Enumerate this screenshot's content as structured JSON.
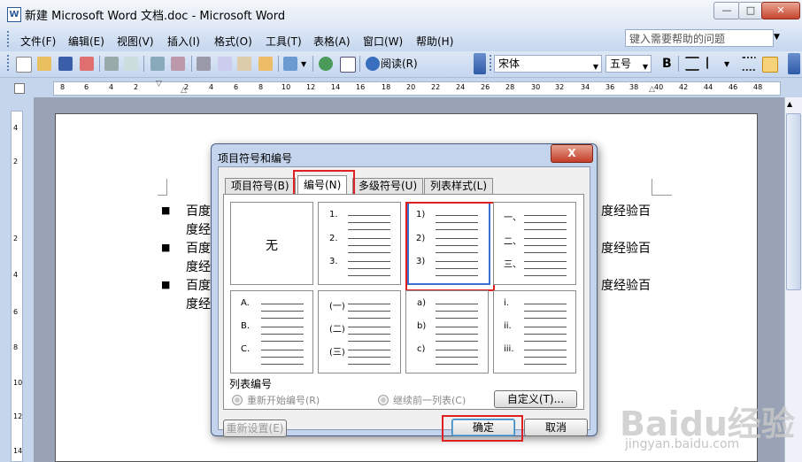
{
  "window": {
    "title": "新建 Microsoft Word 文档.doc - Microsoft Word"
  },
  "menu": [
    "文件(F)",
    "编辑(E)",
    "视图(V)",
    "插入(I)",
    "格式(O)",
    "工具(T)",
    "表格(A)",
    "窗口(W)",
    "帮助(H)"
  ],
  "help_search": {
    "placeholder": "键入需要帮助的问题"
  },
  "toolbar": {
    "reading_label": "阅读(R)",
    "font_name": "宋体",
    "font_size": "五号",
    "bold": "B"
  },
  "ruler": {
    "numbers": [
      "8",
      "6",
      "4",
      "2",
      "2",
      "4",
      "6",
      "8",
      "10",
      "12",
      "14",
      "16",
      "18",
      "20",
      "22",
      "24",
      "26",
      "28",
      "30",
      "32",
      "34",
      "36",
      "38",
      "40",
      "42",
      "44",
      "46",
      "48"
    ]
  },
  "vruler": {
    "numbers": [
      "4",
      "2",
      "2",
      "4",
      "6",
      "8",
      "10",
      "12",
      "14"
    ]
  },
  "document": {
    "left_lines": [
      "百度",
      "度经",
      "百度",
      "度经",
      "百度",
      "度经"
    ],
    "right_lines": [
      "度经验百",
      "度经验百",
      "度经验百"
    ]
  },
  "dialog": {
    "title": "项目符号和编号",
    "close_label": "X",
    "tabs": [
      "项目符号(B)",
      "编号(N)",
      "多级符号(U)",
      "列表样式(L)"
    ],
    "active_tab": 1,
    "none_label": "无",
    "styles": [
      [
        "1.",
        "2.",
        "3."
      ],
      [
        "1)",
        "2)",
        "3)"
      ],
      [
        "一、",
        "二、",
        "三、"
      ],
      [
        "A.",
        "B.",
        "C."
      ],
      [
        "(一)",
        "(二)",
        "(三)"
      ],
      [
        "a)",
        "b)",
        "c)"
      ],
      [
        "i.",
        "ii.",
        "iii."
      ]
    ],
    "list_numbering_label": "列表编号",
    "restart_label": "重新开始编号(R)",
    "continue_label": "继续前一列表(C)",
    "customize_label": "自定义(T)...",
    "reset_label": "重新设置(E)",
    "ok_label": "确定",
    "cancel_label": "取消"
  },
  "watermark": {
    "brand": "Baidu经验",
    "url": "jingyan.baidu.com"
  },
  "colors": {
    "highlight": "#e02020",
    "accent": "#2f5aa8"
  }
}
